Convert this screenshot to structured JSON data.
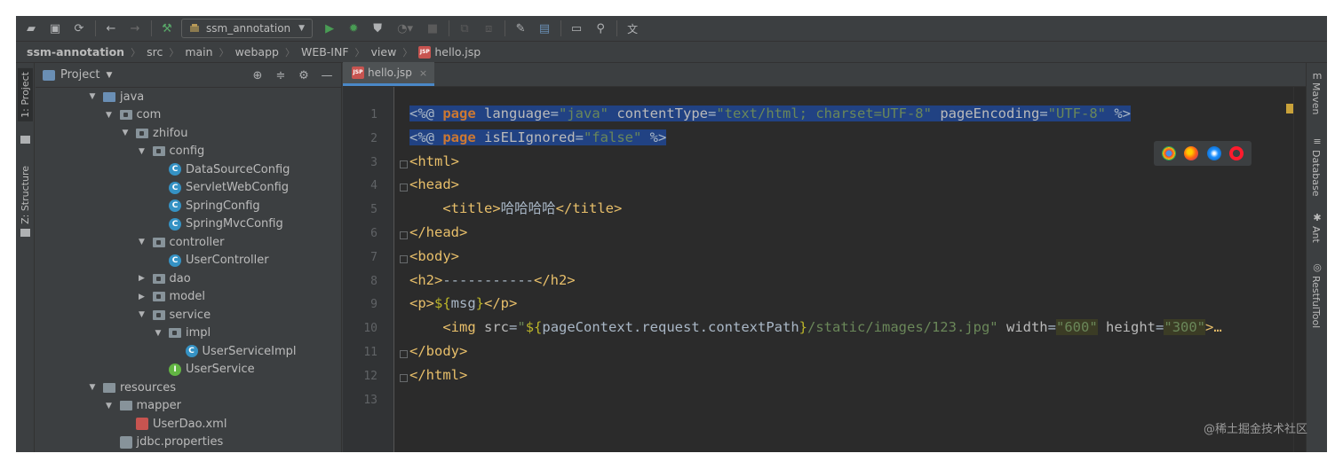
{
  "toolbar": {
    "run_config": "ssm_annotation",
    "icons": [
      "open-folder-icon",
      "save-icon",
      "sync-icon",
      "back-icon",
      "forward-icon",
      "build-hammer-icon",
      "run-icon",
      "debug-icon",
      "coverage-icon",
      "profile-icon",
      "stop-icon",
      "attach-icon",
      "update-icon",
      "settings-wrench-icon",
      "project-structure-icon",
      "terminal-icon",
      "search-icon",
      "translate-icon"
    ]
  },
  "breadcrumb": [
    "ssm-annotation",
    "src",
    "main",
    "webapp",
    "WEB-INF",
    "view",
    "hello.jsp"
  ],
  "left_stripe": {
    "project_tab": "1: Project",
    "structure_tab": "Z: Structure"
  },
  "project_panel": {
    "title": "Project",
    "tree": [
      {
        "label": "java",
        "type": "folder-blue",
        "expanded": true,
        "level": 0
      },
      {
        "label": "com",
        "type": "package",
        "expanded": true,
        "level": 1
      },
      {
        "label": "zhifou",
        "type": "package",
        "expanded": true,
        "level": 2
      },
      {
        "label": "config",
        "type": "package",
        "expanded": true,
        "level": 3
      },
      {
        "label": "DataSourceConfig",
        "type": "class",
        "level": 4
      },
      {
        "label": "ServletWebConfig",
        "type": "class",
        "level": 4
      },
      {
        "label": "SpringConfig",
        "type": "class",
        "level": 4
      },
      {
        "label": "SpringMvcConfig",
        "type": "class",
        "level": 4
      },
      {
        "label": "controller",
        "type": "package",
        "expanded": true,
        "level": 3
      },
      {
        "label": "UserController",
        "type": "class",
        "level": 4
      },
      {
        "label": "dao",
        "type": "package",
        "expanded": false,
        "level": 3
      },
      {
        "label": "model",
        "type": "package",
        "expanded": false,
        "level": 3
      },
      {
        "label": "service",
        "type": "package",
        "expanded": true,
        "level": 3
      },
      {
        "label": "impl",
        "type": "package",
        "expanded": true,
        "level": 4
      },
      {
        "label": "UserServiceImpl",
        "type": "class",
        "level": 5
      },
      {
        "label": "UserService",
        "type": "interface",
        "level": 4
      },
      {
        "label": "resources",
        "type": "folder-res",
        "expanded": true,
        "level": 0
      },
      {
        "label": "mapper",
        "type": "folder",
        "expanded": true,
        "level": 1
      },
      {
        "label": "UserDao.xml",
        "type": "xml",
        "level": 2
      },
      {
        "label": "jdbc.properties",
        "type": "properties",
        "level": 1
      }
    ]
  },
  "editor": {
    "tab": "hello.jsp",
    "line_numbers": [
      "1",
      "2",
      "3",
      "4",
      "5",
      "6",
      "7",
      "8",
      "9",
      "10",
      "11",
      "12",
      "13"
    ],
    "lines": [
      "<%@ page language=\"java\" contentType=\"text/html; charset=UTF-8\" pageEncoding=\"UTF-8\" %>",
      "<%@ page isELIgnored=\"false\" %>",
      "<html>",
      "<head>",
      "    <title>哈哈哈哈</title>",
      "</head>",
      "<body>",
      "<h2>-----------</h2>",
      "<p>${msg}</p>",
      "    <img src=\"${pageContext.request.contextPath}/static/images/123.jpg\" width=\"600\" height=\"300\">…",
      "</body>",
      "</html>",
      ""
    ],
    "selected_lines": [
      1,
      2
    ],
    "browser_icons": [
      "chrome-icon",
      "firefox-icon",
      "safari-icon",
      "opera-icon"
    ]
  },
  "right_stripe": [
    "Maven",
    "Database",
    "Ant",
    "RestfulTool"
  ],
  "watermark": "@稀土掘金技术社区",
  "colors": {
    "bg_panel": "#3c3f41",
    "bg_editor": "#2b2b2b",
    "keyword": "#cc7832",
    "tag": "#e8bf6a",
    "string": "#6a8759",
    "selection": "#214283"
  }
}
